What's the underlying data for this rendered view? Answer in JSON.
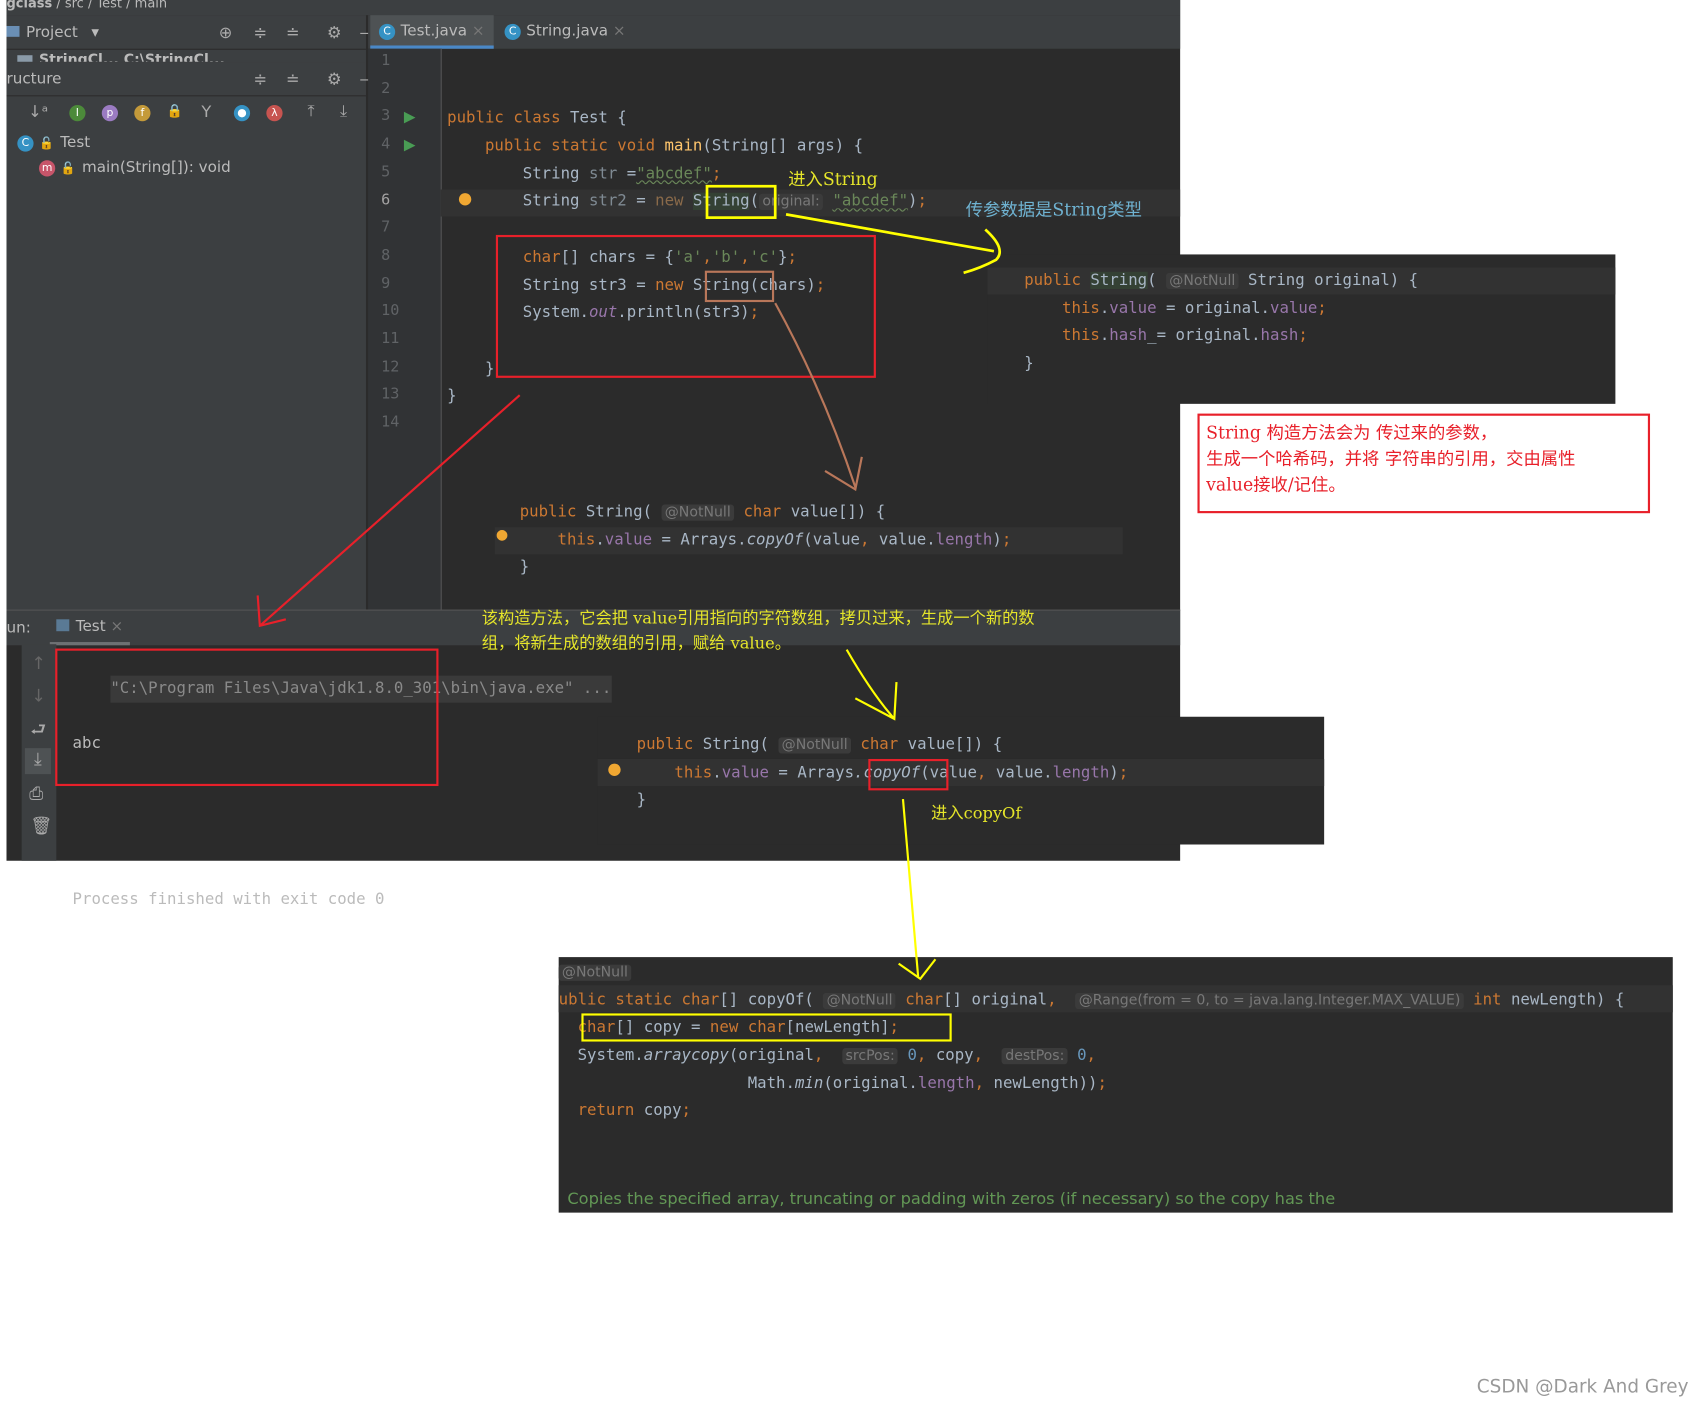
{
  "breadcrumb": [
    "gclass",
    "src",
    "Test",
    "main"
  ],
  "project_panel": {
    "title": "Project",
    "path_hint": "StringCl... C:\\StringCl..."
  },
  "structure_panel": {
    "title": "ructure",
    "tree": [
      {
        "label": "Test",
        "icon": "class-icon"
      },
      {
        "label": "main(String[]): void",
        "icon": "method-icon"
      }
    ]
  },
  "tabs": [
    {
      "label": "Test.java",
      "active": true
    },
    {
      "label": "String.java",
      "active": false
    }
  ],
  "editor": {
    "line_numbers": [
      "1",
      "2",
      "3",
      "4",
      "5",
      "6",
      "7",
      "8",
      "9",
      "10",
      "11",
      "12",
      "13",
      "14"
    ],
    "current_line": "6",
    "lines": [
      [],
      [],
      [
        [
          "public class ",
          "kw"
        ],
        [
          "Test {",
          "id"
        ]
      ],
      [
        [
          "    public static void ",
          "kw"
        ],
        [
          "main",
          "fn"
        ],
        [
          "(String[] args) {",
          "id"
        ]
      ],
      [
        [
          "        String ",
          "id"
        ],
        [
          "str",
          "dim"
        ],
        [
          " =",
          "id"
        ],
        [
          "\"abcdef\"",
          "str"
        ],
        [
          ";",
          "kw"
        ]
      ],
      [
        [
          "        String ",
          "id"
        ],
        [
          "str2",
          "dim"
        ],
        [
          " = ",
          "id"
        ],
        [
          "new ",
          "kwdim"
        ],
        [
          "String",
          "hl"
        ],
        [
          "(",
          "id"
        ],
        [
          "original:",
          "hint"
        ],
        [
          " ",
          "id"
        ],
        [
          "\"abcdef\"",
          "str"
        ],
        [
          ")",
          "id"
        ],
        [
          ";",
          "kw"
        ]
      ],
      [],
      [
        [
          "        char",
          "kw"
        ],
        [
          "[] chars = {",
          "id"
        ],
        [
          "'a'",
          "str2"
        ],
        [
          ",",
          "kw"
        ],
        [
          "'b'",
          "str2"
        ],
        [
          ",",
          "kw"
        ],
        [
          "'c'",
          "str2"
        ],
        [
          "}",
          "id"
        ],
        [
          ";",
          "kw"
        ]
      ],
      [
        [
          "        String str3 = ",
          "id"
        ],
        [
          "new ",
          "kw"
        ],
        [
          "String",
          "id"
        ],
        [
          "(chars)",
          "id"
        ],
        [
          ";",
          "kw"
        ]
      ],
      [
        [
          "        System.",
          "id"
        ],
        [
          "out",
          "fldi"
        ],
        [
          ".println(str3)",
          "id"
        ],
        [
          ";",
          "kw"
        ]
      ],
      [],
      [
        [
          "    }",
          "id"
        ]
      ],
      [
        [
          "}",
          "id"
        ]
      ],
      []
    ],
    "snippet": [
      [
        [
          "public ",
          "kw"
        ],
        [
          "String( ",
          "id"
        ],
        [
          "@NotNull",
          "hint"
        ],
        [
          " char ",
          "kw"
        ],
        [
          "value[]) {",
          "id"
        ]
      ],
      [
        [
          "    this",
          "kw"
        ],
        [
          ".",
          "id"
        ],
        [
          "value",
          "fld"
        ],
        [
          " = Arrays.",
          "id"
        ],
        [
          "copyOf",
          "i"
        ],
        [
          "(value",
          "id"
        ],
        [
          ", ",
          "kw"
        ],
        [
          "value.",
          "id"
        ],
        [
          "length",
          "fld"
        ],
        [
          ")",
          "id"
        ],
        [
          ";",
          "kw"
        ]
      ],
      [
        [
          "}",
          "id"
        ]
      ]
    ]
  },
  "run": {
    "label": "un:",
    "tab": "Test",
    "console": [
      "\"C:\\Program Files\\Java\\jdk1.8.0_301\\bin\\java.exe\" ...",
      "abc",
      "",
      "Process finished with exit code 0"
    ]
  },
  "panel_string_ctor": [
    [
      [
        "public ",
        "kw"
      ],
      [
        "String",
        "hl"
      ],
      [
        "( ",
        "id"
      ],
      [
        "@NotNull",
        "hint"
      ],
      [
        " String original) {",
        "id"
      ]
    ],
    [
      [
        "    this",
        "kw"
      ],
      [
        ".",
        "id"
      ],
      [
        "value",
        "fld"
      ],
      [
        " = original.",
        "id"
      ],
      [
        "value",
        "fld"
      ],
      [
        ";",
        "kw"
      ]
    ],
    [
      [
        "    this",
        "kw"
      ],
      [
        ".",
        "id"
      ],
      [
        "hash",
        "fld"
      ],
      [
        "_= original.",
        "id"
      ],
      [
        "hash",
        "fld"
      ],
      [
        ";",
        "kw"
      ]
    ],
    [
      [
        "}",
        "id"
      ]
    ]
  ],
  "panel_char_ctor": [
    [
      [
        "public ",
        "kw"
      ],
      [
        "String( ",
        "id"
      ],
      [
        "@NotNull",
        "hint"
      ],
      [
        " char ",
        "kw"
      ],
      [
        "value[]) {",
        "id"
      ]
    ],
    [
      [
        "    this",
        "kw"
      ],
      [
        ".",
        "id"
      ],
      [
        "value",
        "fld"
      ],
      [
        " = Arrays",
        "id"
      ],
      [
        ".copyOf",
        "i"
      ],
      [
        "(value",
        "id"
      ],
      [
        ", ",
        "kw"
      ],
      [
        "value.",
        "id"
      ],
      [
        "length",
        "fld"
      ],
      [
        ")",
        "id"
      ],
      [
        ";",
        "kw"
      ]
    ],
    [
      [
        "}",
        "id"
      ]
    ]
  ],
  "panel_copyof": [
    [
      [
        "@NotNull",
        "hint"
      ]
    ],
    [
      [
        "ublic static char",
        "kw"
      ],
      [
        "[] copyOf( ",
        "id"
      ],
      [
        "@NotNull",
        "hint"
      ],
      [
        " char",
        "kw"
      ],
      [
        "[] original",
        "id"
      ],
      [
        ",  ",
        "kw"
      ],
      [
        "@Range(from = 0, to = java.lang.Integer.MAX_VALUE)",
        "hint"
      ],
      [
        " int ",
        "kw"
      ],
      [
        "newLength) {",
        "id"
      ]
    ],
    [
      [
        "  char",
        "kw"
      ],
      [
        "[] copy = ",
        "id"
      ],
      [
        "new char",
        "kw"
      ],
      [
        "[newLength]",
        "id"
      ],
      [
        ";",
        "kw"
      ]
    ],
    [
      [
        "  System.",
        "id"
      ],
      [
        "arraycopy",
        "i"
      ],
      [
        "(original",
        "id"
      ],
      [
        ",  ",
        "kw"
      ],
      [
        "srcPos:",
        "hint"
      ],
      [
        " 0",
        "num"
      ],
      [
        ", ",
        "kw"
      ],
      [
        "copy",
        "id"
      ],
      [
        ",  ",
        "kw"
      ],
      [
        "destPos:",
        "hint"
      ],
      [
        " 0",
        "num"
      ],
      [
        ",",
        "kw"
      ]
    ],
    [
      [
        "                    Math.",
        "id"
      ],
      [
        "min",
        "i"
      ],
      [
        "(original.",
        "id"
      ],
      [
        "length",
        "fld"
      ],
      [
        ", ",
        "kw"
      ],
      [
        "newLength))",
        "id"
      ],
      [
        ";",
        "kw"
      ]
    ],
    [
      [
        "  return ",
        "kw"
      ],
      [
        "copy",
        "id"
      ],
      [
        ";",
        "kw"
      ]
    ]
  ],
  "copyof_doc": "Copies the specified array, truncating or padding with zeros (if necessary) so the copy has the",
  "annotations": {
    "enter_string": "进入String",
    "param_is_string": "传参数据是String类型",
    "ctor_note": [
      "String 构造方法会为 传过来的参数，",
      "生成一个哈希码，并将 字符串的引用，交由属性",
      "value接收/记住。"
    ],
    "char_ctor_note": [
      "该构造方法，它会把 value引用指向的字符数组，拷贝过来，生成一个新的数",
      "组，将新生成的数组的引用，赋给 value。"
    ],
    "enter_copyof": "进入copyOf"
  },
  "watermark": "CSDN @Dark And Grey",
  "colors": {
    "red_box": "#e8202a",
    "yellow_box": "#ffff00",
    "brown_box": "#b9775a",
    "keyword": "#cc7832",
    "identifier": "#a9b7c6",
    "field": "#9876aa",
    "string": "#6a8759"
  }
}
